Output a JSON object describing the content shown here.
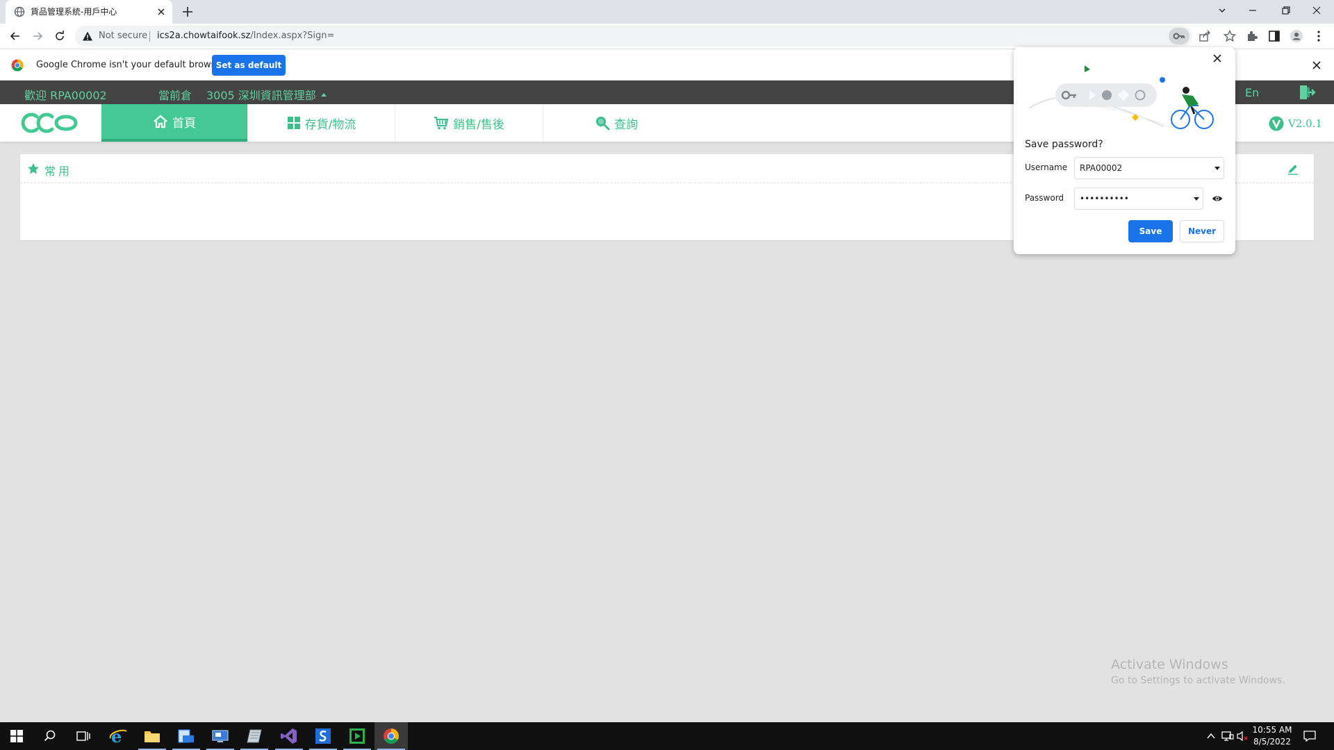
{
  "browser": {
    "tab_title": "貨品管理系統-用戶中心",
    "security_label": "Not secure",
    "url_host": "ics2a.chowtaifook.sz",
    "url_path": "/Index.aspx?Sign="
  },
  "infobar": {
    "message": "Google Chrome isn't your default browser",
    "button_label": "Set as default"
  },
  "app": {
    "welcome": "歡迎 RPA00002",
    "current_store_label": "當前倉",
    "current_store_value": "3005 深圳資訊管理部",
    "language": "En",
    "version": "V2.0.1",
    "nav": [
      {
        "label": "首頁",
        "icon": "home-icon",
        "active": true
      },
      {
        "label": "存貨/物流",
        "icon": "grid-icon",
        "active": false
      },
      {
        "label": "銷售/售後",
        "icon": "cart-icon",
        "active": false
      },
      {
        "label": "查詢",
        "icon": "search-icon",
        "active": false
      }
    ],
    "favorites_title": "常用"
  },
  "password_bubble": {
    "title": "Save password?",
    "username_label": "Username",
    "username_value": "RPA00002",
    "password_label": "Password",
    "password_value": "••••••••••",
    "save_label": "Save",
    "never_label": "Never"
  },
  "watermark": {
    "title": "Activate Windows",
    "subtitle": "Go to Settings to activate Windows."
  },
  "taskbar": {
    "time": "10:55 AM",
    "date": "8/5/2022"
  },
  "colors": {
    "accent_green": "#45c994",
    "header_dark": "#444444",
    "chrome_blue": "#1a73e8"
  }
}
